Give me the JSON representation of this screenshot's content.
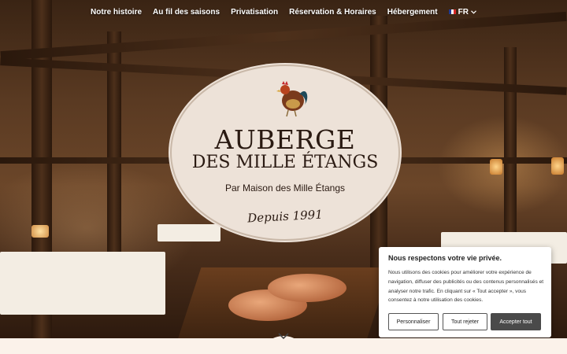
{
  "nav": {
    "items": [
      {
        "label": "Notre histoire"
      },
      {
        "label": "Au fil des saisons"
      },
      {
        "label": "Privatisation"
      },
      {
        "label": "Réservation & Horaires"
      },
      {
        "label": "Hébergement"
      }
    ],
    "language": "FR",
    "language_icon": "chevron-down-icon"
  },
  "logo": {
    "title_line1": "AUBERGE",
    "title_line2": "DES MILLE ÉTANGS",
    "subtitle": "Par Maison des Mille Étangs",
    "since": "Depuis 1991",
    "icon": "rooster-icon"
  },
  "cookie_banner": {
    "title": "Nous respectons votre vie privée.",
    "text": "Nous utilisons des cookies pour améliorer votre expérience de navigation, diffuser des publicités ou des contenus personnalisés et analyser notre trafic. En cliquant sur « Tout accepter », vous consentez à notre utilisation des cookies.",
    "customize_label": "Personnaliser",
    "reject_label": "Tout rejeter",
    "accept_label": "Accepter tout"
  },
  "scroll_icon": "chevron-down-icon",
  "colors": {
    "logo_bg": "#ede2d8",
    "accept_button": "#4a4a4a",
    "footer_strip": "#fbf2ea"
  }
}
